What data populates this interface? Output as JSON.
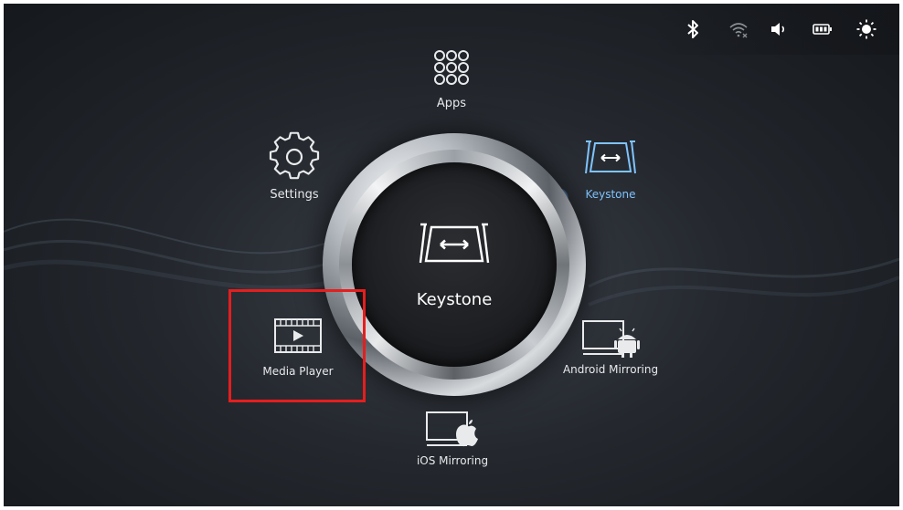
{
  "status_bar": {
    "icons": [
      "bluetooth-icon",
      "wifi-icon",
      "volume-icon",
      "battery-icon",
      "brightness-icon"
    ]
  },
  "menu": {
    "apps": "Apps",
    "settings": "Settings",
    "keystone": "Keystone",
    "media_player": "Media Player",
    "android_mirroring": "Android Mirroring",
    "ios_mirroring": "iOS Mirroring"
  },
  "center": {
    "title": "Keystone"
  },
  "colors": {
    "active_accent": "#7fc4ff",
    "highlight_border": "#e51e1e"
  }
}
